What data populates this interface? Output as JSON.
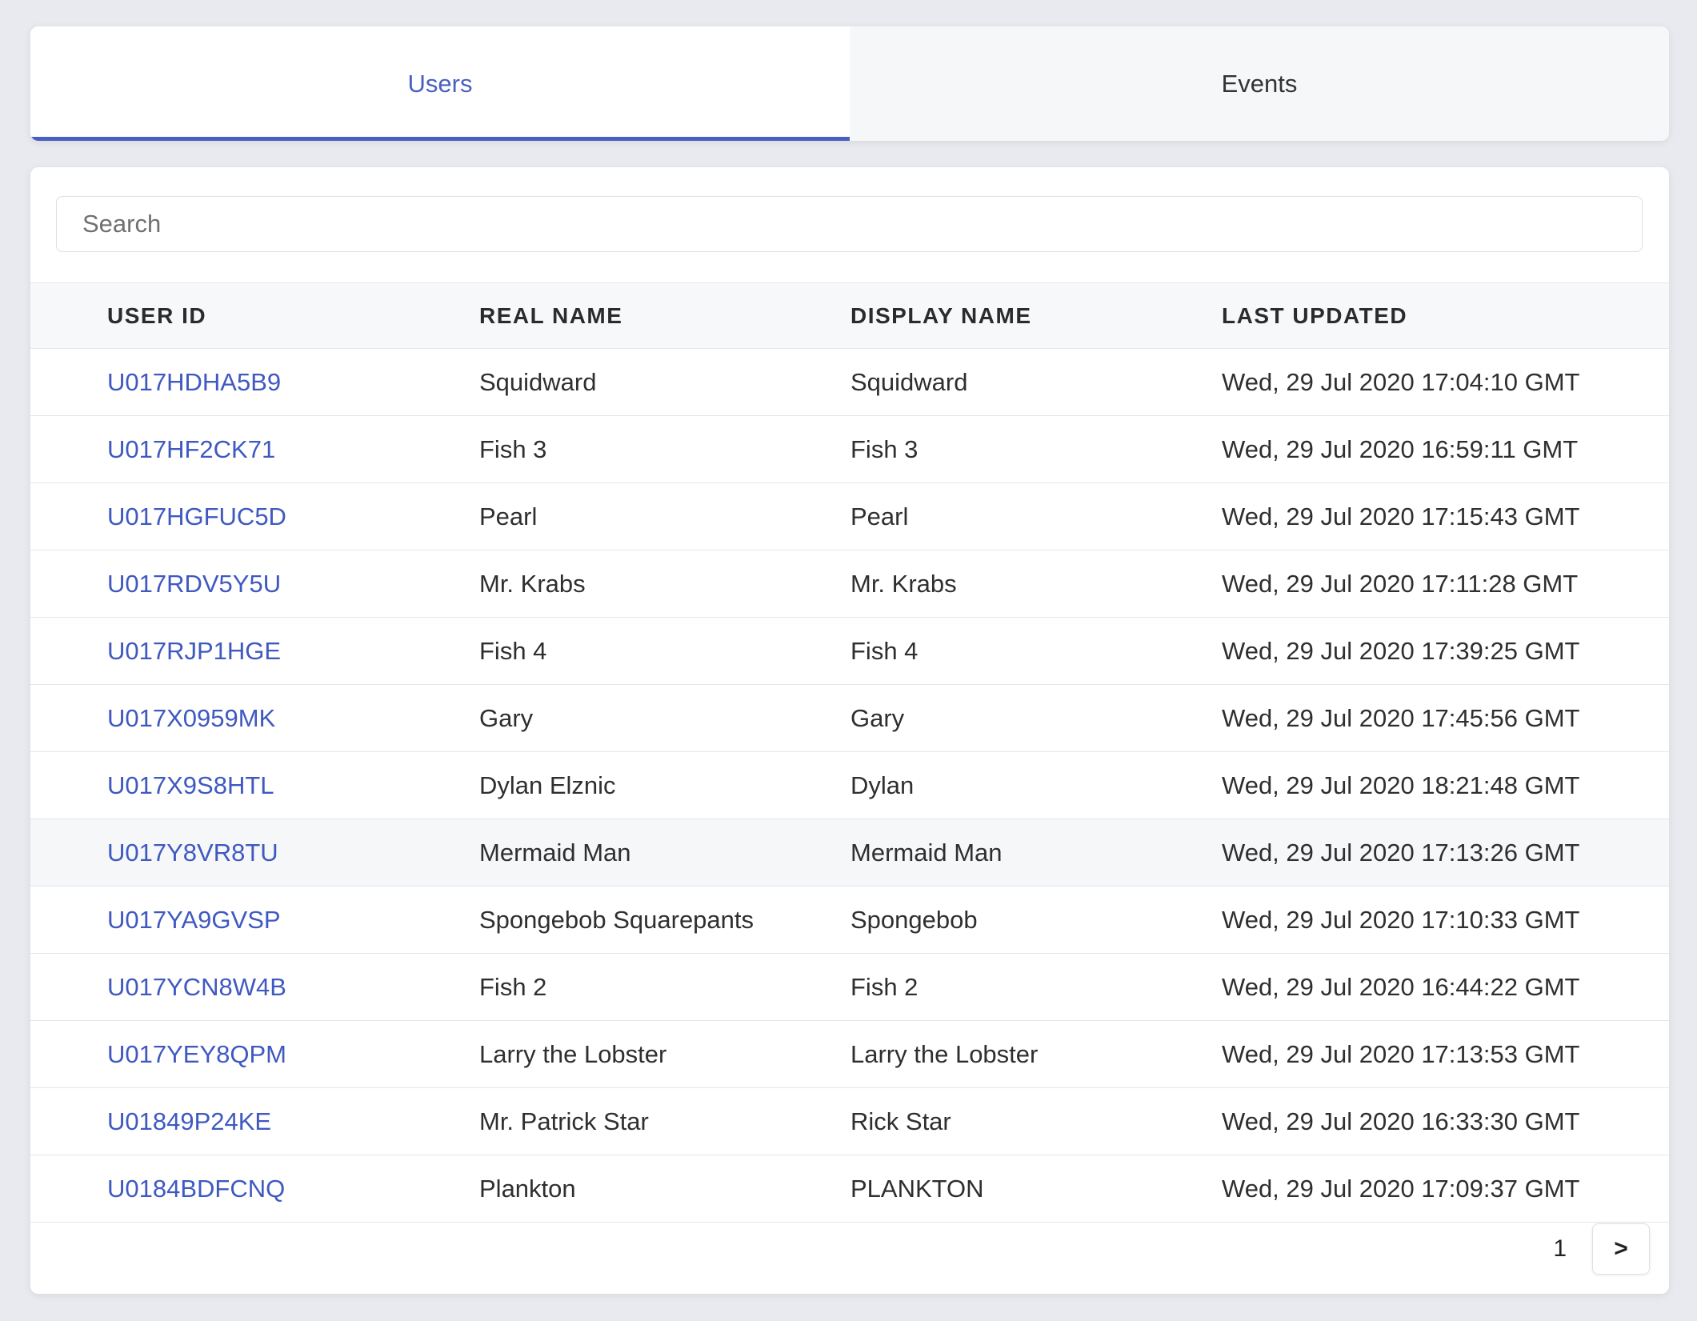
{
  "tabs": [
    {
      "label": "Users",
      "active": true
    },
    {
      "label": "Events",
      "active": false
    }
  ],
  "search": {
    "placeholder": "Search",
    "value": ""
  },
  "table": {
    "headers": [
      "USER ID",
      "REAL NAME",
      "DISPLAY NAME",
      "LAST UPDATED"
    ],
    "rows": [
      {
        "user_id": "U017HDHA5B9",
        "real_name": "Squidward",
        "display_name": "Squidward",
        "last_updated": "Wed, 29 Jul 2020 17:04:10 GMT"
      },
      {
        "user_id": "U017HF2CK71",
        "real_name": "Fish 3",
        "display_name": "Fish 3",
        "last_updated": "Wed, 29 Jul 2020 16:59:11 GMT"
      },
      {
        "user_id": "U017HGFUC5D",
        "real_name": "Pearl",
        "display_name": "Pearl",
        "last_updated": "Wed, 29 Jul 2020 17:15:43 GMT"
      },
      {
        "user_id": "U017RDV5Y5U",
        "real_name": "Mr. Krabs",
        "display_name": "Mr. Krabs",
        "last_updated": "Wed, 29 Jul 2020 17:11:28 GMT"
      },
      {
        "user_id": "U017RJP1HGE",
        "real_name": "Fish 4",
        "display_name": "Fish 4",
        "last_updated": "Wed, 29 Jul 2020 17:39:25 GMT"
      },
      {
        "user_id": "U017X0959MK",
        "real_name": "Gary",
        "display_name": "Gary",
        "last_updated": "Wed, 29 Jul 2020 17:45:56 GMT"
      },
      {
        "user_id": "U017X9S8HTL",
        "real_name": "Dylan Elznic",
        "display_name": "Dylan",
        "last_updated": "Wed, 29 Jul 2020 18:21:48 GMT"
      },
      {
        "user_id": "U017Y8VR8TU",
        "real_name": "Mermaid Man",
        "display_name": "Mermaid Man",
        "last_updated": "Wed, 29 Jul 2020 17:13:26 GMT"
      },
      {
        "user_id": "U017YA9GVSP",
        "real_name": "Spongebob Squarepants",
        "display_name": "Spongebob",
        "last_updated": "Wed, 29 Jul 2020 17:10:33 GMT"
      },
      {
        "user_id": "U017YCN8W4B",
        "real_name": "Fish 2",
        "display_name": "Fish 2",
        "last_updated": "Wed, 29 Jul 2020 16:44:22 GMT"
      },
      {
        "user_id": "U017YEY8QPM",
        "real_name": "Larry the Lobster",
        "display_name": "Larry the Lobster",
        "last_updated": "Wed, 29 Jul 2020 17:13:53 GMT"
      },
      {
        "user_id": "U01849P24KE",
        "real_name": "Mr. Patrick Star",
        "display_name": "Rick Star",
        "last_updated": "Wed, 29 Jul 2020 16:33:30 GMT"
      },
      {
        "user_id": "U0184BDFCNQ",
        "real_name": "Plankton",
        "display_name": "PLANKTON",
        "last_updated": "Wed, 29 Jul 2020 17:09:37 GMT"
      }
    ],
    "highlighted_row_index": 7
  },
  "pagination": {
    "current_page": "1",
    "next_label": ">"
  },
  "colors": {
    "accent": "#4a5fc1",
    "link": "#3f59c0",
    "background": "#e8eaef"
  }
}
